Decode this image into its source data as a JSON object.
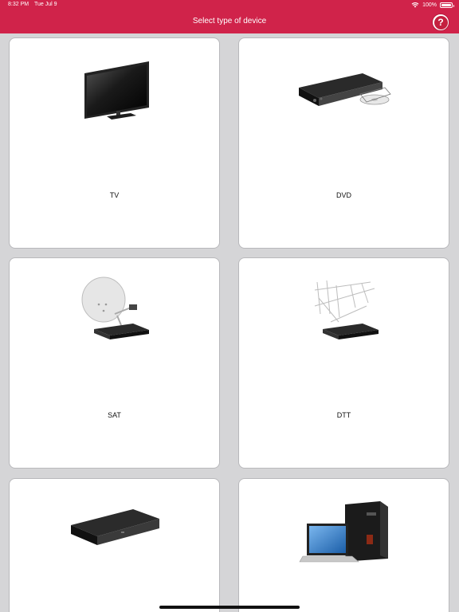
{
  "status_bar": {
    "time": "8:32 PM",
    "date": "Tue Jul 9",
    "battery": "100%",
    "battery_level": 1.0
  },
  "header": {
    "title": "Select type of device",
    "help_label": "?"
  },
  "devices": [
    {
      "label": "TV",
      "icon": "tv-icon"
    },
    {
      "label": "DVD",
      "icon": "dvd-player-icon"
    },
    {
      "label": "SAT",
      "icon": "satellite-receiver-icon"
    },
    {
      "label": "DTT",
      "icon": "antenna-receiver-icon"
    },
    {
      "label": "",
      "icon": "set-top-box-icon"
    },
    {
      "label": "",
      "icon": "computer-icon"
    }
  ],
  "colors": {
    "header_bg": "#d0234a",
    "page_bg": "#d5d5d7",
    "card_bg": "#ffffff"
  }
}
